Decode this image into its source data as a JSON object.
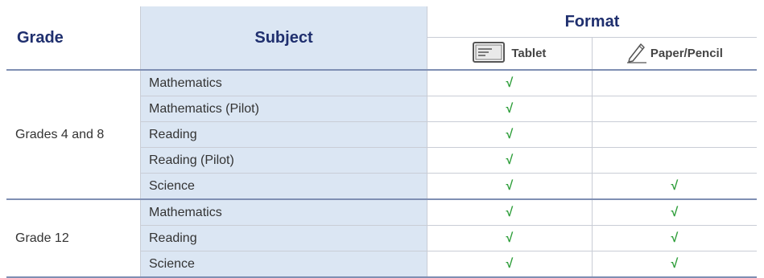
{
  "header": {
    "grade": "Grade",
    "subject": "Subject",
    "format": "Format",
    "tablet": "Tablet",
    "paper": "Paper/Pencil"
  },
  "check_mark": "√",
  "groups": [
    {
      "grade": "Grades 4 and 8",
      "rows": [
        {
          "subject": "Mathematics",
          "tablet": true,
          "paper": false
        },
        {
          "subject": "Mathematics (Pilot)",
          "tablet": true,
          "paper": false
        },
        {
          "subject": "Reading",
          "tablet": true,
          "paper": false
        },
        {
          "subject": "Reading (Pilot)",
          "tablet": true,
          "paper": false
        },
        {
          "subject": "Science",
          "tablet": true,
          "paper": true
        }
      ]
    },
    {
      "grade": "Grade 12",
      "rows": [
        {
          "subject": "Mathematics",
          "tablet": true,
          "paper": true
        },
        {
          "subject": "Reading",
          "tablet": true,
          "paper": true
        },
        {
          "subject": "Science",
          "tablet": true,
          "paper": true
        }
      ]
    }
  ],
  "colors": {
    "check": "#2e9e3a",
    "header_text": "#1f2f6e",
    "subject_bg": "#dbe6f3"
  },
  "icons": {
    "tablet": "tablet-icon",
    "paper": "pencil-icon"
  }
}
